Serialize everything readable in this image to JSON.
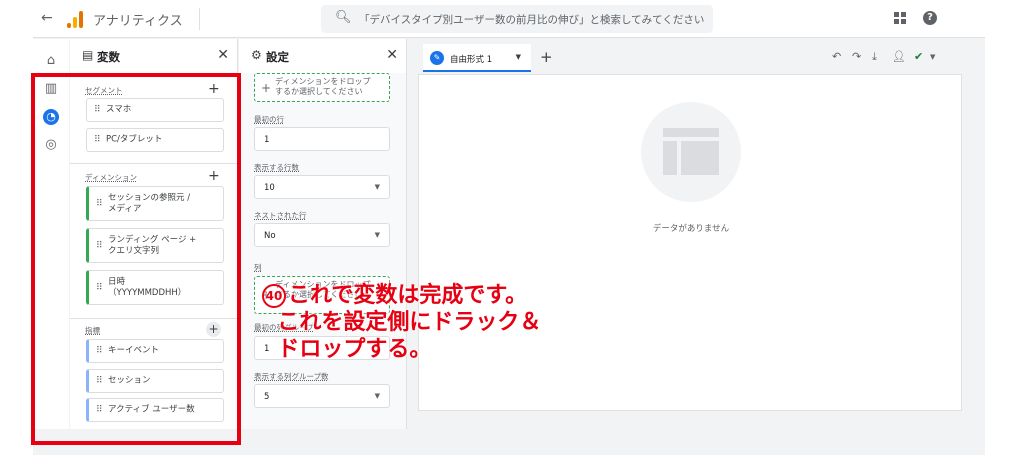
{
  "header": {
    "back_icon": "arrow-left-icon",
    "app_title": "アナリティクス",
    "search_placeholder": "「デバイスタイプ別ユーザー数の前月比の伸び」と検索してみてください"
  },
  "variables_panel": {
    "title": "変数",
    "segments": {
      "label": "セグメント",
      "items": [
        "スマホ",
        "PC/タブレット"
      ]
    },
    "dimensions": {
      "label": "ディメンション",
      "items": [
        "セッションの参照元 /\nメディア",
        "ランディング ページ +\nクエリ文字列",
        "日時\n（YYYYMMDDHH）"
      ]
    },
    "metrics": {
      "label": "指標",
      "items": [
        "キーイベント",
        "セッション",
        "アクティブ ユーザー数"
      ]
    }
  },
  "settings_panel": {
    "title": "設定",
    "drop_rows": "ディメンションをドロップ\nするか選択してください",
    "start_row_label": "最初の行",
    "start_row_value": "1",
    "show_rows_label": "表示する行数",
    "show_rows_value": "10",
    "nested_rows_label": "ネストされた行",
    "nested_rows_value": "No",
    "columns_label": "列",
    "drop_columns": "ディメンションをドロップ\nするか選択してください",
    "start_col_group_label": "最初の列グループ",
    "start_col_group_value": "1",
    "show_col_groups_label": "表示する列グループ数",
    "show_col_groups_value": "5"
  },
  "canvas": {
    "tab_label": "自由形式 1",
    "empty_message": "データがありません"
  },
  "annotation": {
    "number": "40",
    "line1": "これで変数は完成です。",
    "line2": "これを設定側にドラック＆",
    "line3": "ドロップする。"
  },
  "colors": {
    "accent": "#1a73e8",
    "annotation_red": "#e60012",
    "dimension_green": "#34a853",
    "metric_blue": "#8ab4f8"
  }
}
